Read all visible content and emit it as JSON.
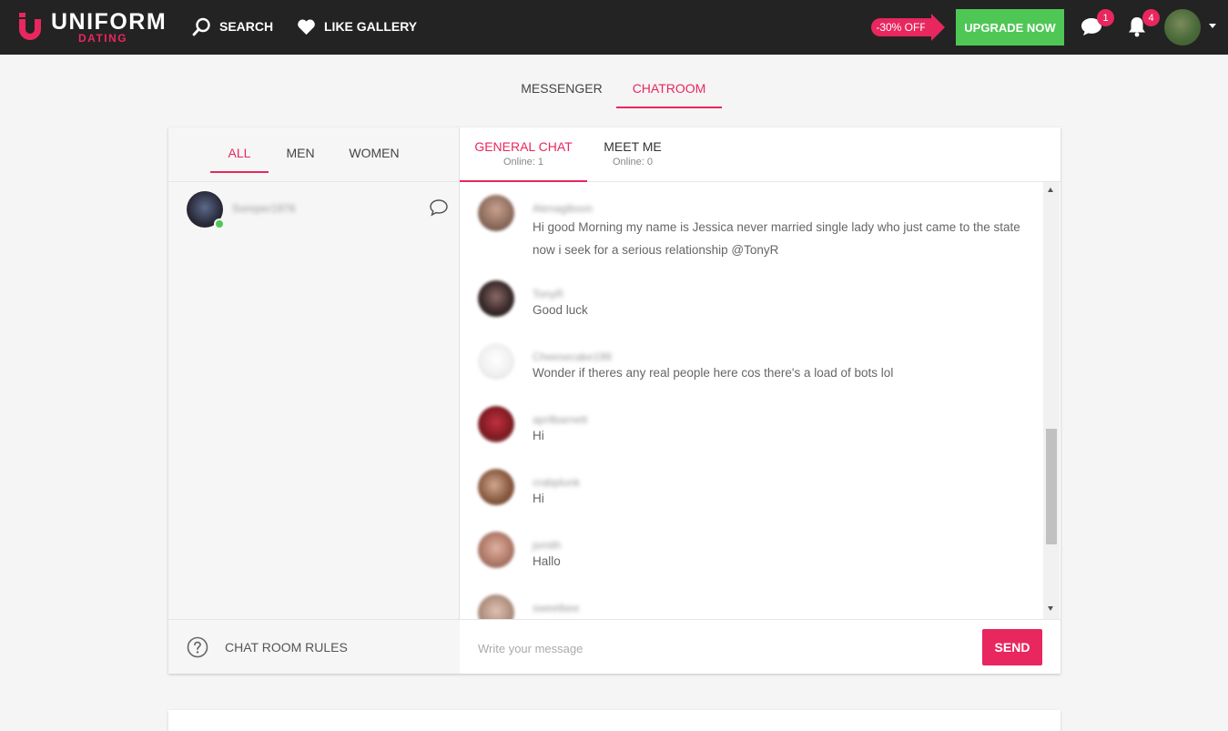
{
  "brand": {
    "name": "UNIFORM",
    "sub": "DATING"
  },
  "nav": {
    "search_label": "SEARCH",
    "like_gallery_label": "LIKE GALLERY"
  },
  "promo": {
    "discount_label": "-30% OFF",
    "upgrade_label": "UPGRADE NOW"
  },
  "header": {
    "messages_count": "1",
    "notifications_count": "4"
  },
  "page_tabs": [
    {
      "label": "MESSENGER",
      "active": false
    },
    {
      "label": "CHATROOM",
      "active": true
    }
  ],
  "filter_tabs": [
    {
      "label": "ALL",
      "active": true
    },
    {
      "label": "MEN",
      "active": false
    },
    {
      "label": "WOMEN",
      "active": false
    }
  ],
  "online_users": [
    {
      "name": "Soreper1976"
    }
  ],
  "rules": {
    "label": "CHAT ROOM RULES"
  },
  "room_tabs": [
    {
      "title": "GENERAL CHAT",
      "subtitle": "Online: 1",
      "active": true
    },
    {
      "title": "MEET ME",
      "subtitle": "Online: 0",
      "active": false
    }
  ],
  "messages": [
    {
      "name": "Alenagibson",
      "text": "Hi good Morning my name is Jessica never married single lady who just came to the state now i seek for a serious relationship @TonyR"
    },
    {
      "name": "TonyR",
      "text": "Good luck"
    },
    {
      "name": "Cheesecake199",
      "text": "Wonder if theres any real people here cos there's a load of bots lol"
    },
    {
      "name": "aprilbarnett",
      "text": "Hi"
    },
    {
      "name": "crabplunk",
      "text": "Hi"
    },
    {
      "name": "jsmith",
      "text": "Hallo"
    },
    {
      "name": "sweetbee",
      "text": ""
    }
  ],
  "composer": {
    "placeholder": "Write your message",
    "send_label": "SEND"
  },
  "colors": {
    "accent": "#e8275f",
    "upgrade": "#4fc755",
    "topbar": "#232323"
  }
}
